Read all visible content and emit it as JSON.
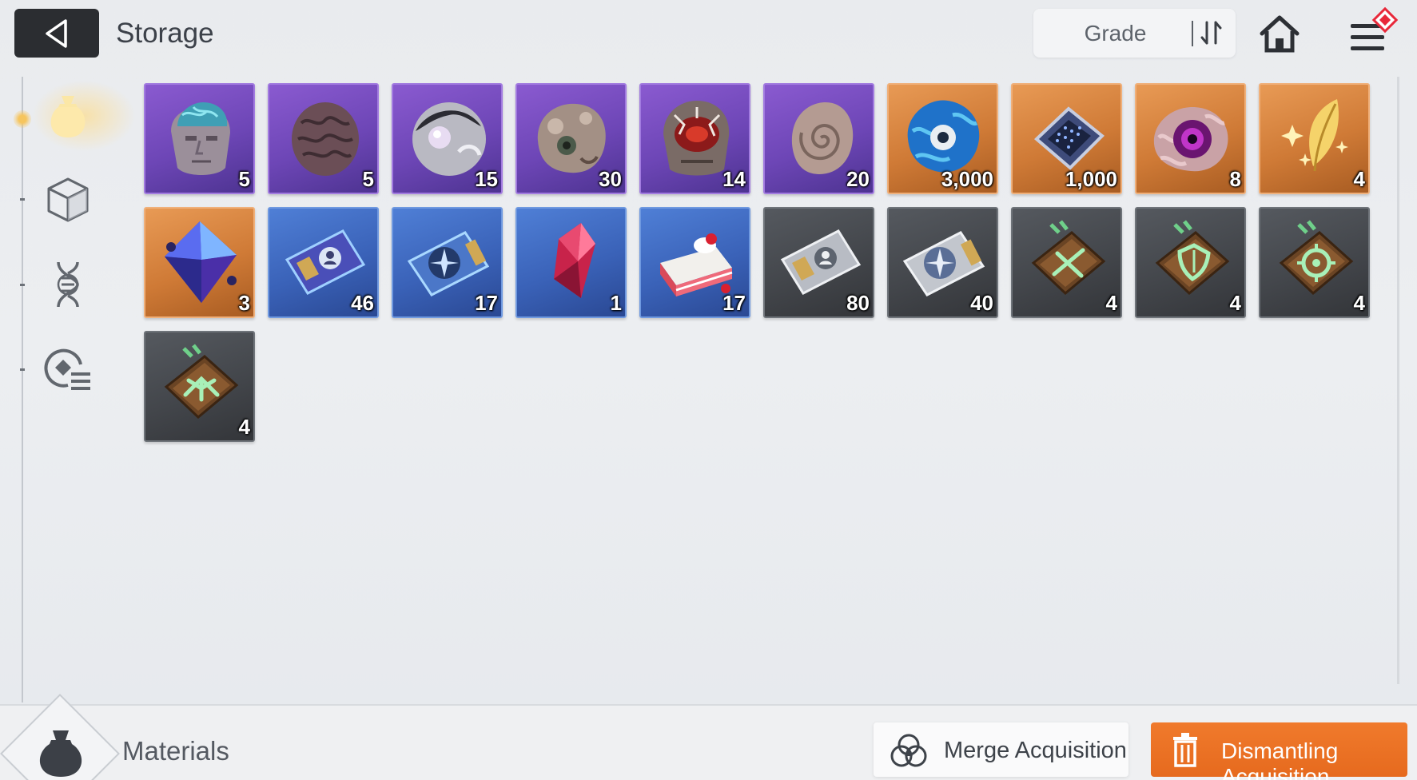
{
  "header": {
    "title": "Storage",
    "sort_label": "Grade"
  },
  "icons": {
    "back": "back-arrow-icon",
    "sort": "sort-toggle-icon",
    "home": "home-icon",
    "menu": "menu-icon"
  },
  "category_tabs": [
    {
      "name": "materials",
      "icon": "bag-icon",
      "active": true
    },
    {
      "name": "items",
      "icon": "cube-icon",
      "active": false
    },
    {
      "name": "genes",
      "icon": "dna-icon",
      "active": false
    },
    {
      "name": "list",
      "icon": "list-icon",
      "active": false
    }
  ],
  "items": [
    {
      "quantity": "5",
      "rarity": "purple",
      "icon": "exposed-brain-head-icon"
    },
    {
      "quantity": "5",
      "rarity": "purple",
      "icon": "brain-icon"
    },
    {
      "quantity": "15",
      "rarity": "purple",
      "icon": "silver-orb-icon"
    },
    {
      "quantity": "30",
      "rarity": "purple",
      "icon": "monster-skull-icon"
    },
    {
      "quantity": "14",
      "rarity": "purple",
      "icon": "cracked-skull-icon"
    },
    {
      "quantity": "20",
      "rarity": "purple",
      "icon": "spiral-shell-icon"
    },
    {
      "quantity": "3,000",
      "rarity": "orange",
      "icon": "blue-eye-creature-icon"
    },
    {
      "quantity": "1,000",
      "rarity": "orange",
      "icon": "data-chip-icon"
    },
    {
      "quantity": "8",
      "rarity": "orange",
      "icon": "purple-eye-icon"
    },
    {
      "quantity": "4",
      "rarity": "orange",
      "icon": "golden-feather-icon"
    },
    {
      "quantity": "3",
      "rarity": "orange",
      "icon": "blue-crystal-icon"
    },
    {
      "quantity": "46",
      "rarity": "blue",
      "icon": "character-ticket-icon"
    },
    {
      "quantity": "17",
      "rarity": "blue",
      "icon": "compass-ticket-icon"
    },
    {
      "quantity": "1",
      "rarity": "blue",
      "icon": "red-crystal-icon"
    },
    {
      "quantity": "17",
      "rarity": "blue",
      "icon": "cake-icon"
    },
    {
      "quantity": "80",
      "rarity": "grey",
      "icon": "character-ticket-silver-icon"
    },
    {
      "quantity": "40",
      "rarity": "grey",
      "icon": "compass-ticket-silver-icon"
    },
    {
      "quantity": "4",
      "rarity": "grey",
      "icon": "sword-book-icon"
    },
    {
      "quantity": "4",
      "rarity": "grey",
      "icon": "shield-book-icon"
    },
    {
      "quantity": "4",
      "rarity": "grey",
      "icon": "target-book-icon"
    },
    {
      "quantity": "4",
      "rarity": "grey",
      "icon": "wings-book-icon"
    }
  ],
  "footer": {
    "category_label": "Materials",
    "merge_label": "Merge Acquisition",
    "dismantle_label": "Dismantling Acquisition"
  },
  "colors": {
    "purple": "#6d46b6",
    "orange": "#cf7a36",
    "blue": "#3a62b8",
    "grey": "#43464b",
    "accent": "#e66a1e",
    "notification": "#e8283a"
  }
}
